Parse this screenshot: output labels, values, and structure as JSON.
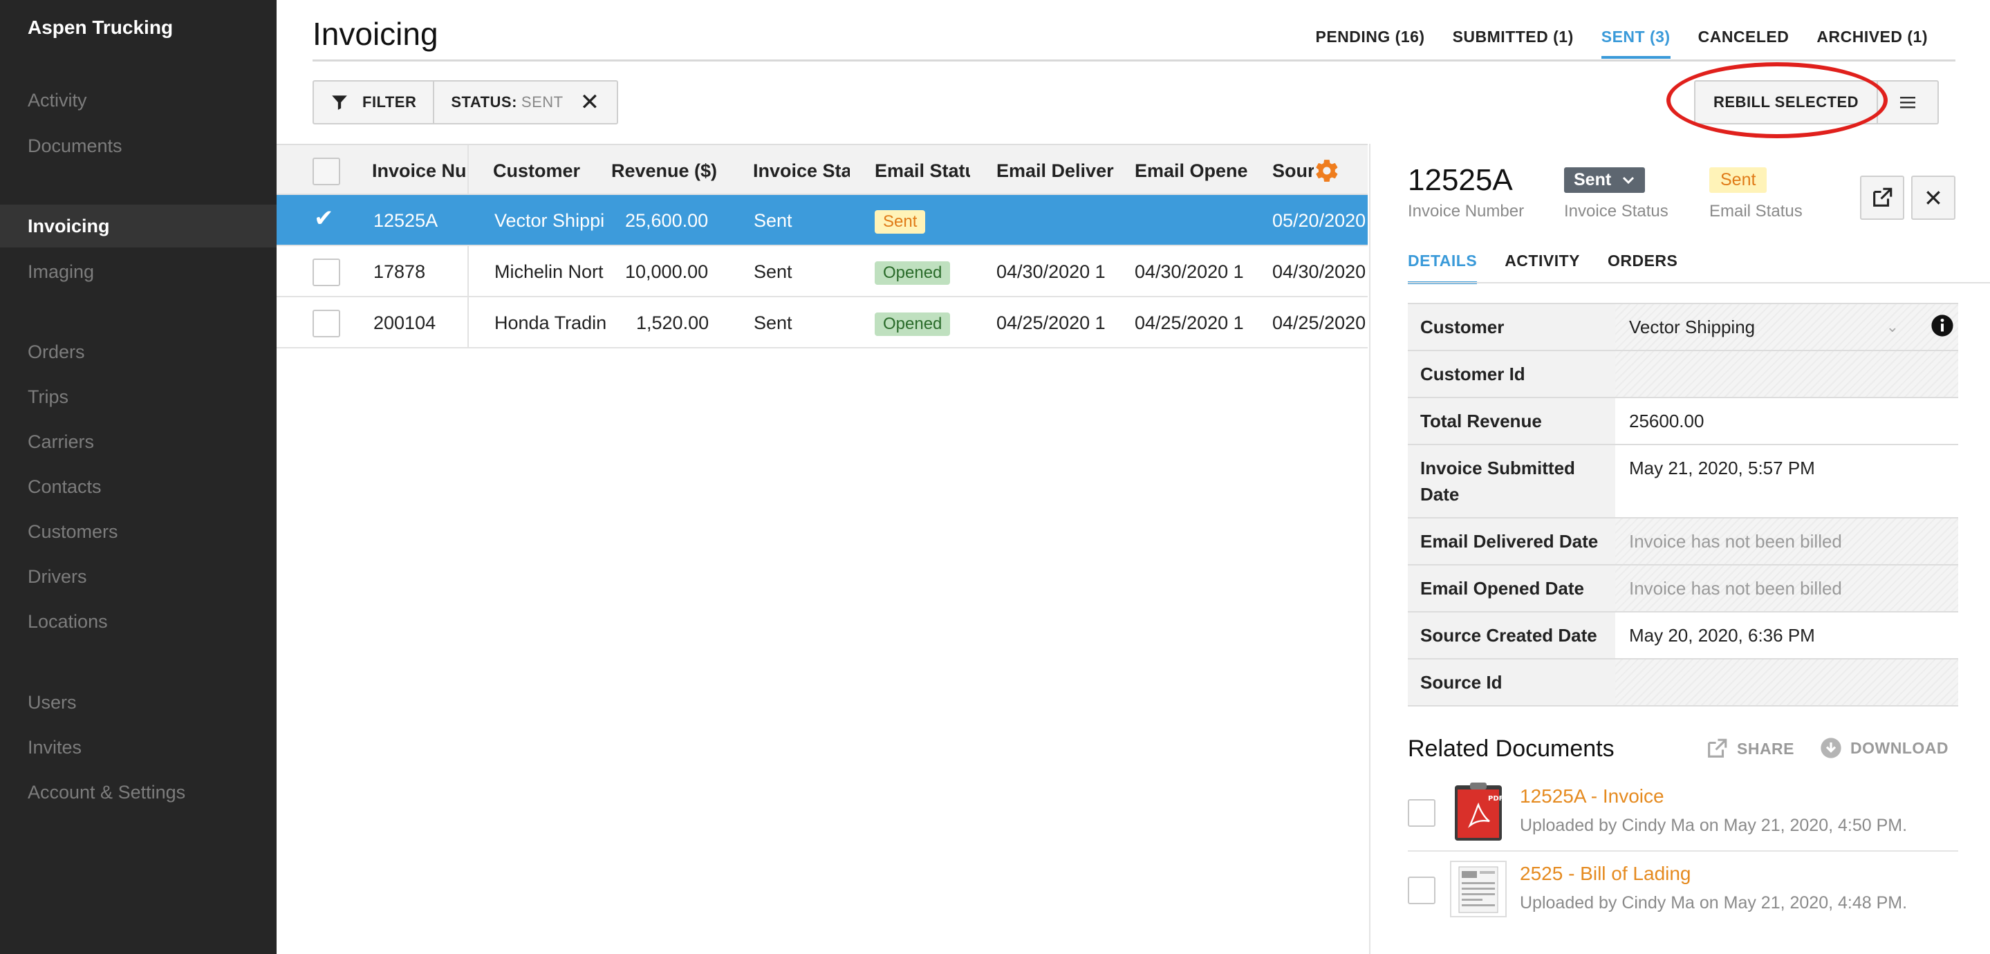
{
  "app": {
    "brand": "Aspen Trucking"
  },
  "sidebar": {
    "items": [
      {
        "label": "Activity"
      },
      {
        "label": "Documents"
      },
      {
        "label": "Invoicing"
      },
      {
        "label": "Imaging"
      },
      {
        "label": "Orders"
      },
      {
        "label": "Trips"
      },
      {
        "label": "Carriers"
      },
      {
        "label": "Contacts"
      },
      {
        "label": "Customers"
      },
      {
        "label": "Drivers"
      },
      {
        "label": "Locations"
      },
      {
        "label": "Users"
      },
      {
        "label": "Invites"
      },
      {
        "label": "Account & Settings"
      }
    ],
    "active": "Invoicing"
  },
  "header": {
    "title": "Invoicing",
    "tabs": [
      {
        "label": "PENDING (16)"
      },
      {
        "label": "SUBMITTED (1)"
      },
      {
        "label": "SENT (3)"
      },
      {
        "label": "CANCELED"
      },
      {
        "label": "ARCHIVED (1)"
      }
    ],
    "active_tab": "SENT (3)"
  },
  "toolbar": {
    "filter_label": "FILTER",
    "status_label": "STATUS:",
    "status_value": "SENT",
    "rebill_label": "REBILL SELECTED"
  },
  "table": {
    "columns": [
      "Invoice Nu",
      "Customer",
      "Revenue ($)",
      "Invoice Sta",
      "Email Statu",
      "Email Deliver",
      "Email Opene",
      "Sourc"
    ],
    "rows": [
      {
        "invoice": "12525A",
        "customer": "Vector Shippi",
        "revenue": "25,600.00",
        "status": "Sent",
        "email_status": "Sent",
        "delivered": "",
        "opened": "",
        "source": "05/20/2020",
        "selected": true
      },
      {
        "invoice": "17878",
        "customer": "Michelin Nort",
        "revenue": "10,000.00",
        "status": "Sent",
        "email_status": "Opened",
        "delivered": "04/30/2020 1",
        "opened": "04/30/2020 1",
        "source": "04/30/2020",
        "selected": false
      },
      {
        "invoice": "200104",
        "customer": "Honda Tradin",
        "revenue": "1,520.00",
        "status": "Sent",
        "email_status": "Opened",
        "delivered": "04/25/2020 1",
        "opened": "04/25/2020 1",
        "source": "04/25/2020",
        "selected": false
      }
    ]
  },
  "panel": {
    "invoice_number": "12525A",
    "invoice_number_label": "Invoice Number",
    "invoice_status": "Sent",
    "invoice_status_label": "Invoice Status",
    "email_status": "Sent",
    "email_status_label": "Email Status",
    "tabs": [
      {
        "label": "DETAILS"
      },
      {
        "label": "ACTIVITY"
      },
      {
        "label": "ORDERS"
      }
    ],
    "details": [
      {
        "label": "Customer",
        "value": "Vector Shipping"
      },
      {
        "label": "Customer Id",
        "value": ""
      },
      {
        "label": "Total Revenue",
        "value": "25600.00"
      },
      {
        "label": "Invoice Submitted Date",
        "value": "May 21, 2020, 5:57 PM"
      },
      {
        "label": "Email Delivered Date",
        "value": "Invoice has not been billed"
      },
      {
        "label": "Email Opened Date",
        "value": "Invoice has not been billed"
      },
      {
        "label": "Source Created Date",
        "value": "May 20, 2020, 6:36 PM"
      },
      {
        "label": "Source Id",
        "value": ""
      }
    ],
    "related": {
      "title": "Related Documents",
      "share_label": "SHARE",
      "download_label": "DOWNLOAD",
      "docs": [
        {
          "title": "12525A - Invoice",
          "subtitle": "Uploaded by Cindy Ma on May 21, 2020, 4:50 PM."
        },
        {
          "title": "2525 - Bill of Lading",
          "subtitle": "Uploaded by Cindy Ma on May 21, 2020, 4:48 PM."
        }
      ]
    }
  },
  "colors": {
    "sidebar_bg": "#262626",
    "accent": "#3a9ad9",
    "selected_row": "#3d9bdb",
    "highlight_ring": "#e0201c",
    "link_orange": "#e58a1f"
  }
}
